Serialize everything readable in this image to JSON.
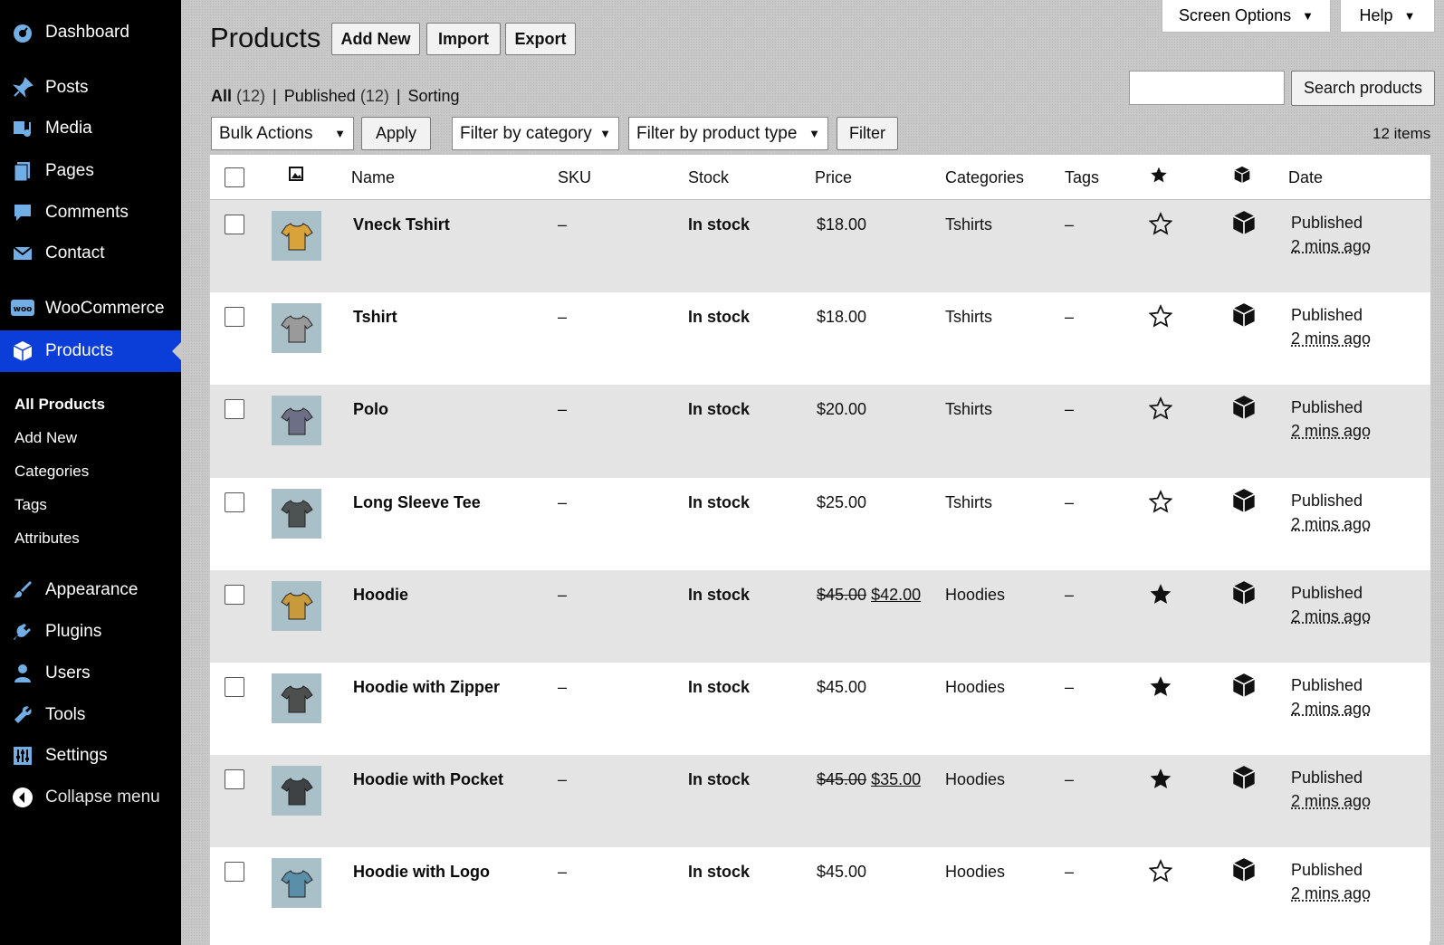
{
  "sidebar": {
    "items": [
      {
        "label": "Dashboard",
        "icon": "dashboard-icon"
      },
      {
        "label": "Posts",
        "icon": "pin-icon"
      },
      {
        "label": "Media",
        "icon": "media-icon"
      },
      {
        "label": "Pages",
        "icon": "pages-icon"
      },
      {
        "label": "Comments",
        "icon": "comment-icon"
      },
      {
        "label": "Contact",
        "icon": "mail-icon"
      },
      {
        "label": "WooCommerce",
        "icon": "woo-icon"
      },
      {
        "label": "Products",
        "icon": "box-icon"
      },
      {
        "label": "Appearance",
        "icon": "brush-icon"
      },
      {
        "label": "Plugins",
        "icon": "plug-icon"
      },
      {
        "label": "Users",
        "icon": "user-icon"
      },
      {
        "label": "Tools",
        "icon": "wrench-icon"
      },
      {
        "label": "Settings",
        "icon": "sliders-icon"
      },
      {
        "label": "Collapse menu",
        "icon": "collapse-icon"
      }
    ],
    "submenu": [
      "All Products",
      "Add New",
      "Categories",
      "Tags",
      "Attributes"
    ]
  },
  "header": {
    "title": "Products",
    "add_new": "Add New",
    "import": "Import",
    "export": "Export",
    "screen_options": "Screen Options",
    "help": "Help"
  },
  "views": {
    "all_label": "All",
    "all_count": "(12)",
    "published_label": "Published",
    "published_count": "(12)",
    "sorting": "Sorting",
    "separator": "|"
  },
  "search": {
    "button": "Search products",
    "value": ""
  },
  "filters": {
    "bulk_actions": "Bulk Actions",
    "apply": "Apply",
    "category": "Filter by category",
    "product_type": "Filter by product type",
    "filter": "Filter",
    "items_count": "12 items"
  },
  "table": {
    "columns": [
      "Name",
      "SKU",
      "Stock",
      "Price",
      "Categories",
      "Tags",
      "Date"
    ],
    "rows": [
      {
        "name": "Vneck Tshirt",
        "sku": "–",
        "stock": "In stock",
        "price": "$18.00",
        "old_price": "",
        "category": "Tshirts",
        "tags": "–",
        "featured": false,
        "status": "Published",
        "ago": "2 mins ago",
        "thumb_color": "#d9a23a"
      },
      {
        "name": "Tshirt",
        "sku": "–",
        "stock": "In stock",
        "price": "$18.00",
        "old_price": "",
        "category": "Tshirts",
        "tags": "–",
        "featured": false,
        "status": "Published",
        "ago": "2 mins ago",
        "thumb_color": "#9a9a9a"
      },
      {
        "name": "Polo",
        "sku": "–",
        "stock": "In stock",
        "price": "$20.00",
        "old_price": "",
        "category": "Tshirts",
        "tags": "–",
        "featured": false,
        "status": "Published",
        "ago": "2 mins ago",
        "thumb_color": "#6d6f86"
      },
      {
        "name": "Long Sleeve Tee",
        "sku": "–",
        "stock": "In stock",
        "price": "$25.00",
        "old_price": "",
        "category": "Tshirts",
        "tags": "–",
        "featured": false,
        "status": "Published",
        "ago": "2 mins ago",
        "thumb_color": "#4d5352"
      },
      {
        "name": "Hoodie",
        "sku": "–",
        "stock": "In stock",
        "price": "$42.00",
        "old_price": "$45.00",
        "category": "Hoodies",
        "tags": "–",
        "featured": true,
        "status": "Published",
        "ago": "2 mins ago",
        "thumb_color": "#c99a3c"
      },
      {
        "name": "Hoodie with Zipper",
        "sku": "–",
        "stock": "In stock",
        "price": "$45.00",
        "old_price": "",
        "category": "Hoodies",
        "tags": "–",
        "featured": true,
        "status": "Published",
        "ago": "2 mins ago",
        "thumb_color": "#4c4f4e"
      },
      {
        "name": "Hoodie with Pocket",
        "sku": "–",
        "stock": "In stock",
        "price": "$35.00",
        "old_price": "$45.00",
        "category": "Hoodies",
        "tags": "–",
        "featured": true,
        "status": "Published",
        "ago": "2 mins ago",
        "thumb_color": "#3e4244"
      },
      {
        "name": "Hoodie with Logo",
        "sku": "–",
        "stock": "In stock",
        "price": "$45.00",
        "old_price": "",
        "category": "Hoodies",
        "tags": "–",
        "featured": false,
        "status": "Published",
        "ago": "2 mins ago",
        "thumb_color": "#5b8ea8"
      }
    ]
  },
  "colors": {
    "active_menu": "#0b3dd8",
    "sidebar_bg": "#000000",
    "icon_blue": "#72aee6"
  }
}
